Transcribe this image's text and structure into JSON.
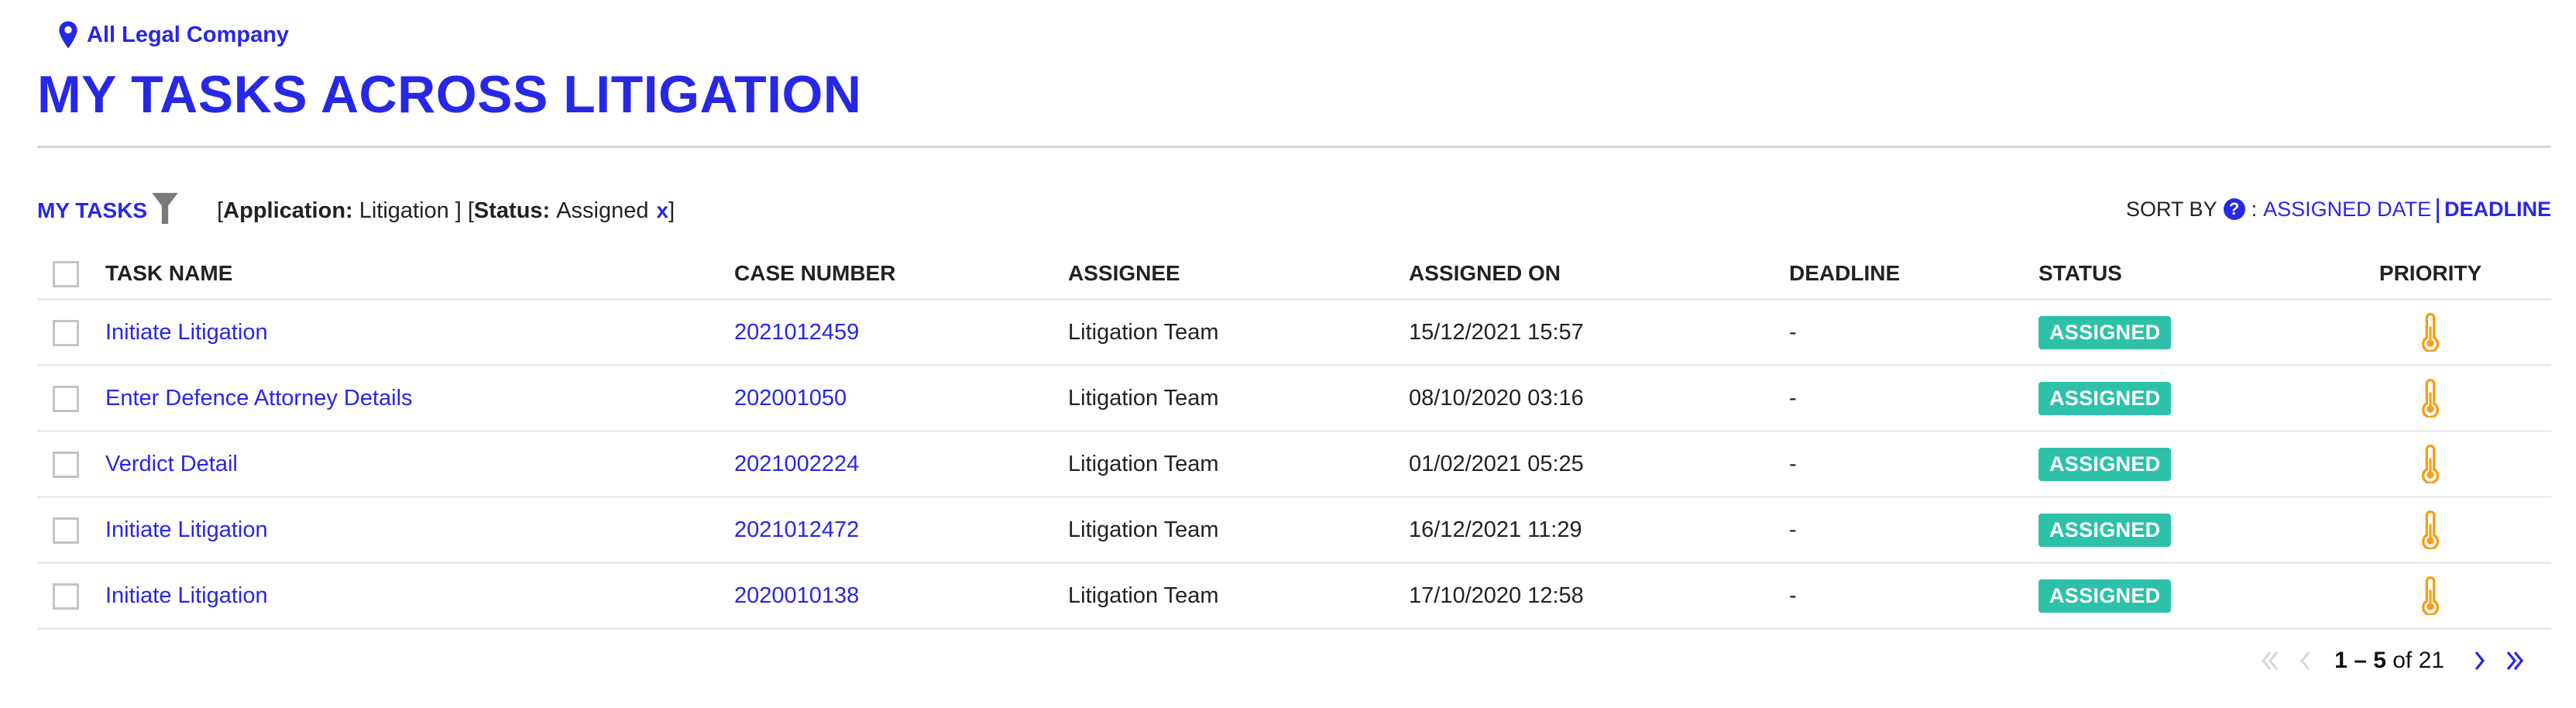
{
  "location": {
    "icon": "map-pin-icon",
    "label": "All Legal Company"
  },
  "page_title": "MY TASKS ACROSS LITIGATION",
  "filter_bar": {
    "my_tasks_label": "MY TASKS",
    "filter_icon": "funnel-icon",
    "filters": [
      {
        "key": "Application:",
        "value": "Litigation"
      },
      {
        "key": "Status:",
        "value": "Assigned"
      }
    ],
    "clear_icon": "x-icon",
    "clear_label": "x"
  },
  "sort": {
    "label": "SORT BY",
    "help_icon": "question-circle-icon",
    "help_glyph": "?",
    "colon": ":",
    "options": [
      {
        "label": "ASSIGNED DATE",
        "active": false
      },
      {
        "label": "DEADLINE",
        "active": true
      }
    ],
    "separator": "|"
  },
  "table": {
    "columns": [
      "TASK NAME",
      "CASE NUMBER",
      "ASSIGNEE",
      "ASSIGNED ON",
      "DEADLINE",
      "STATUS",
      "PRIORITY"
    ],
    "rows": [
      {
        "task_name": "Initiate Litigation",
        "case_number": "2021012459",
        "assignee": "Litigation Team",
        "assigned_on": "15/12/2021 15:57",
        "deadline": "-",
        "status": "ASSIGNED",
        "priority_icon": "thermometer-icon"
      },
      {
        "task_name": "Enter Defence Attorney Details",
        "case_number": "202001050",
        "assignee": "Litigation Team",
        "assigned_on": "08/10/2020 03:16",
        "deadline": "-",
        "status": "ASSIGNED",
        "priority_icon": "thermometer-icon"
      },
      {
        "task_name": "Verdict Detail",
        "case_number": "2021002224",
        "assignee": "Litigation Team",
        "assigned_on": "01/02/2021 05:25",
        "deadline": "-",
        "status": "ASSIGNED",
        "priority_icon": "thermometer-icon"
      },
      {
        "task_name": "Initiate Litigation",
        "case_number": "2021012472",
        "assignee": "Litigation Team",
        "assigned_on": "16/12/2021 11:29",
        "deadline": "-",
        "status": "ASSIGNED",
        "priority_icon": "thermometer-icon"
      },
      {
        "task_name": "Initiate Litigation",
        "case_number": "2020010138",
        "assignee": "Litigation Team",
        "assigned_on": "17/10/2020 12:58",
        "deadline": "-",
        "status": "ASSIGNED",
        "priority_icon": "thermometer-icon"
      }
    ]
  },
  "pagination": {
    "range": "1 – 5",
    "of_label": "of",
    "total": "21",
    "first_enabled": false,
    "prev_enabled": false,
    "next_enabled": true,
    "last_enabled": true
  },
  "colors": {
    "brand_blue": "#2727e6",
    "status_assigned": "#2ec1a9",
    "priority_orange": "#f5a01a",
    "disabled_gray": "#d8d8d8",
    "funnel_gray": "#7a7a7a"
  }
}
